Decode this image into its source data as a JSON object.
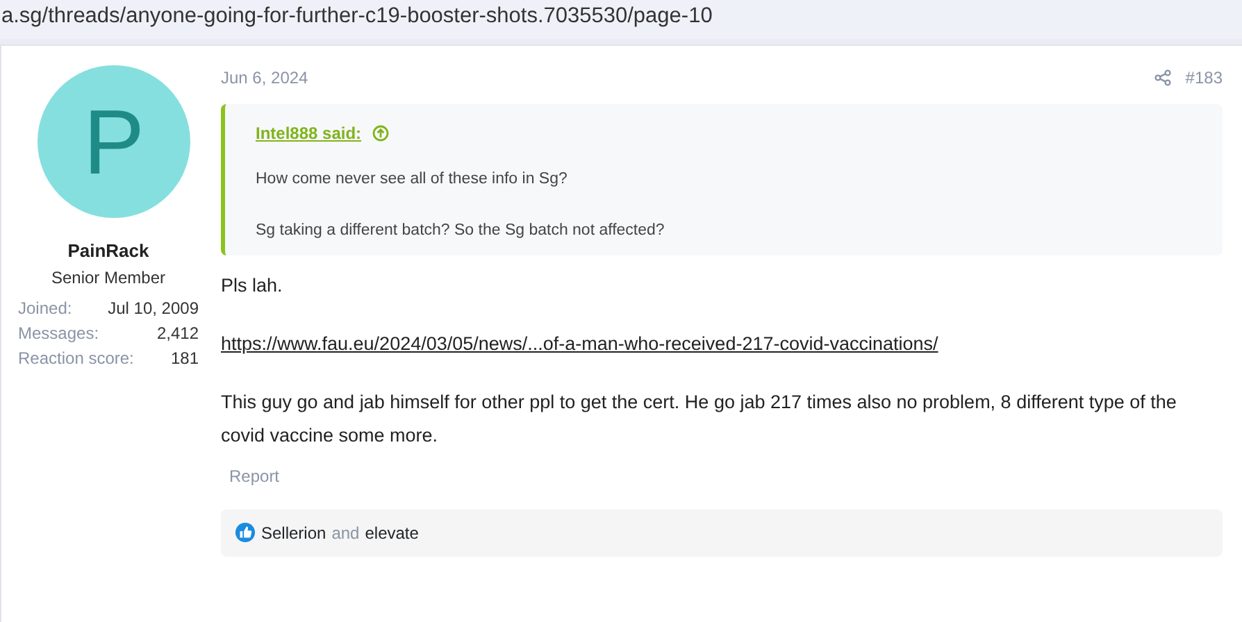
{
  "address_bar": {
    "url": "a.sg/threads/anyone-going-for-further-c19-booster-shots.7035530/page-10"
  },
  "author": {
    "initial": "P",
    "name": "PainRack",
    "title": "Senior Member",
    "stats": [
      {
        "label": "Joined:",
        "value": "Jul 10, 2009"
      },
      {
        "label": "Messages:",
        "value": "2,412"
      },
      {
        "label": "Reaction score:",
        "value": "181"
      }
    ]
  },
  "post": {
    "date": "Jun 6, 2024",
    "number": "#183",
    "quote": {
      "author": "Intel888 said:",
      "lines": [
        "How come never see all of these info in Sg?",
        "Sg taking a different batch? So the Sg batch not affected?"
      ]
    },
    "body": [
      {
        "kind": "text",
        "text": "Pls lah."
      },
      {
        "kind": "link",
        "text": "https://www.fau.eu/2024/03/05/news/...of-a-man-who-received-217-covid-vaccinations/"
      },
      {
        "kind": "text",
        "text": "This guy go and jab himself for other ppl to get the cert. He go jab 217 times also no problem, 8 different type of the covid vaccine some more."
      }
    ],
    "actions": [
      "Report"
    ],
    "reactions": {
      "users": [
        "Sellerion",
        "elevate"
      ],
      "conjunction": "and"
    }
  }
}
